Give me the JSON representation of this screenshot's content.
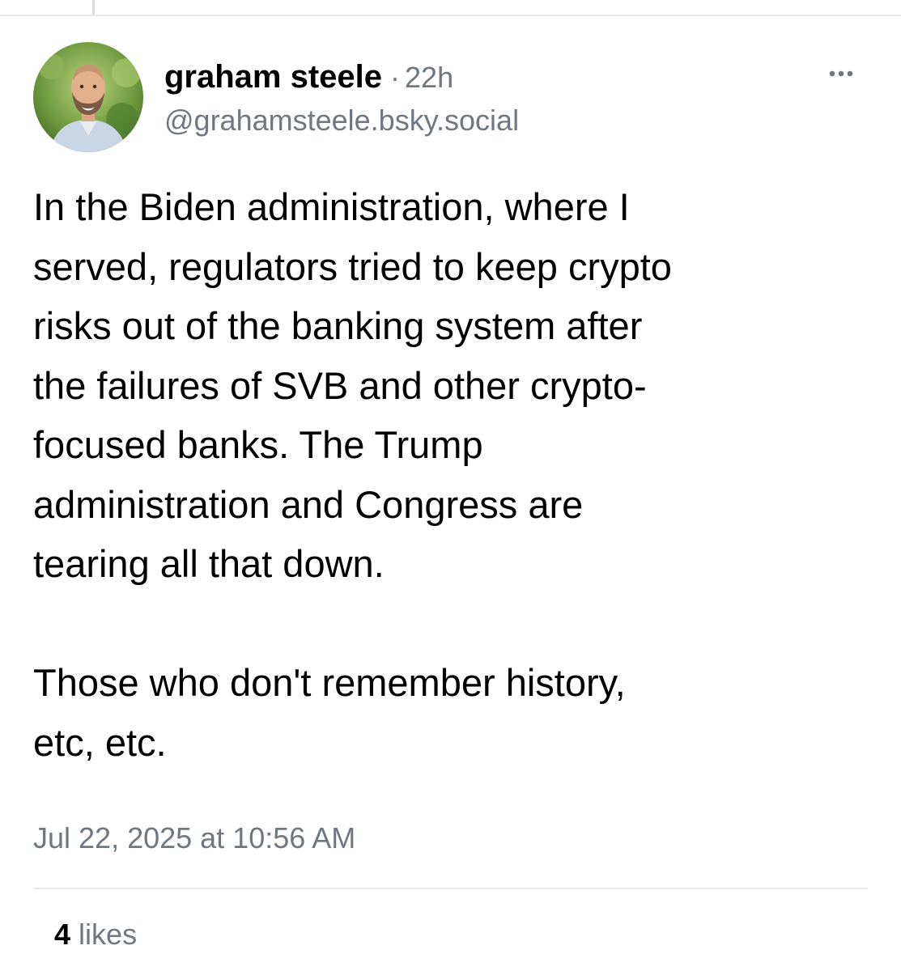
{
  "post": {
    "author": {
      "display_name": "graham steele",
      "handle": "@grahamsteele.bsky.social",
      "avatar_icon": "profile-photo"
    },
    "separator": "·",
    "time_ago": "22h",
    "more_icon": "ellipsis-icon",
    "text_paragraphs": [
      "In the Biden administration, where I\nserved, regulators tried to keep crypto\nrisks out of the banking system after\nthe failures of SVB and other crypto-\nfocused banks. The Trump\nadministration and Congress are\ntearing all that down.",
      "Those who don't remember history,\netc, etc."
    ],
    "timestamp": "Jul 22, 2025 at 10:56 AM",
    "likes": {
      "count": "4",
      "label": "likes"
    }
  },
  "colors": {
    "secondary_text": "#6f7780",
    "divider": "#e6e8eb",
    "primary_text": "#000000"
  }
}
